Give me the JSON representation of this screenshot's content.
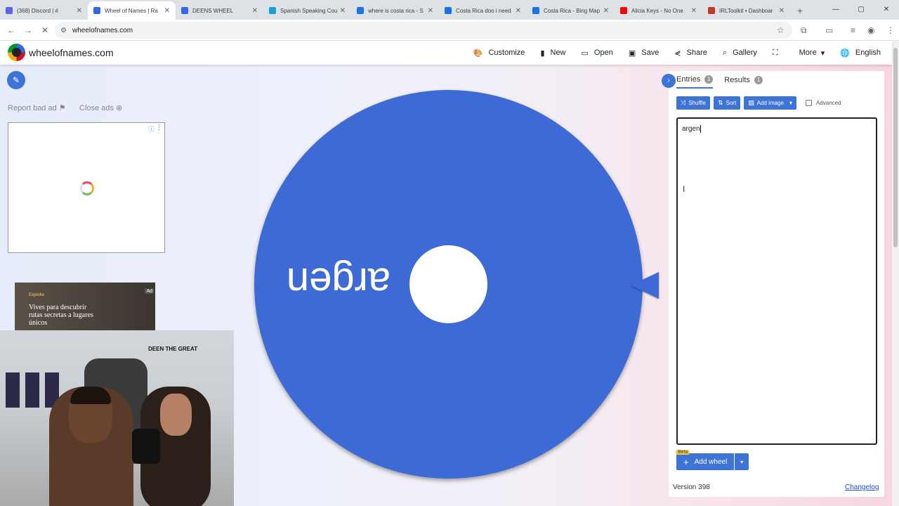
{
  "browser": {
    "tabs": [
      {
        "title": "(368) Discord | #",
        "favicon_color": "#5865f2",
        "active": false
      },
      {
        "title": "Wheel of Names | Ra",
        "favicon_color": "#3369e8",
        "active": true
      },
      {
        "title": "DEENS WHEEL",
        "favicon_color": "#3369e8",
        "active": false
      },
      {
        "title": "Spanish Speaking Cou",
        "favicon_color": "#1a9fd8",
        "active": false
      },
      {
        "title": "where is costa rica - S",
        "favicon_color": "#1a73e8",
        "active": false
      },
      {
        "title": "Costa Rica doo i need",
        "favicon_color": "#1a73e8",
        "active": false
      },
      {
        "title": "Costa Rica - Bing Map",
        "favicon_color": "#1a73e8",
        "active": false
      },
      {
        "title": "Alicia Keys - No One",
        "favicon_color": "#ff0000",
        "active": false
      },
      {
        "title": "IRLToolkit • Dashboar",
        "favicon_color": "#c0392b",
        "active": false
      }
    ],
    "new_tab": "+",
    "url": "wheelofnames.com"
  },
  "site": {
    "brand": "wheelofnames.com",
    "menu": [
      {
        "label": "Customize",
        "icon": "palette-icon",
        "glyph": "🎨"
      },
      {
        "label": "New",
        "icon": "file-icon",
        "glyph": "▮"
      },
      {
        "label": "Open",
        "icon": "folder-icon",
        "glyph": "▭"
      },
      {
        "label": "Save",
        "icon": "save-icon",
        "glyph": "▣"
      },
      {
        "label": "Share",
        "icon": "share-icon",
        "glyph": "⋞"
      },
      {
        "label": "Gallery",
        "icon": "search-icon",
        "glyph": "⌕"
      },
      {
        "label": "",
        "icon": "fullscreen-icon",
        "glyph": "⛶"
      },
      {
        "label": "More",
        "icon": "chevron-down-icon",
        "glyph": "▾"
      },
      {
        "label": "English",
        "icon": "globe-icon",
        "glyph": "🌐"
      }
    ]
  },
  "left": {
    "report_ad": "Report bad ad",
    "close_ads": "Close ads",
    "ad2_text": "Vives para descubrir rutas secretas a lugares únicos",
    "ad2_brand": "Expedia",
    "ad_tag": "Ad",
    "webcam_sign": "DEEN THE GREAT"
  },
  "wheel": {
    "color": "#3e6ad6",
    "segment_label": "argen"
  },
  "panel": {
    "tabs": [
      {
        "label": "Entries",
        "count": "1"
      },
      {
        "label": "Results",
        "count": "1"
      }
    ],
    "toolbar": {
      "shuffle": "Shuffle",
      "sort": "Sort",
      "add_image": "Add image",
      "advanced": "Advanced"
    },
    "entries_text": "argen",
    "beta": "Beta",
    "add_wheel": "Add wheel",
    "version": "Version 398",
    "changelog": "Changelog"
  }
}
